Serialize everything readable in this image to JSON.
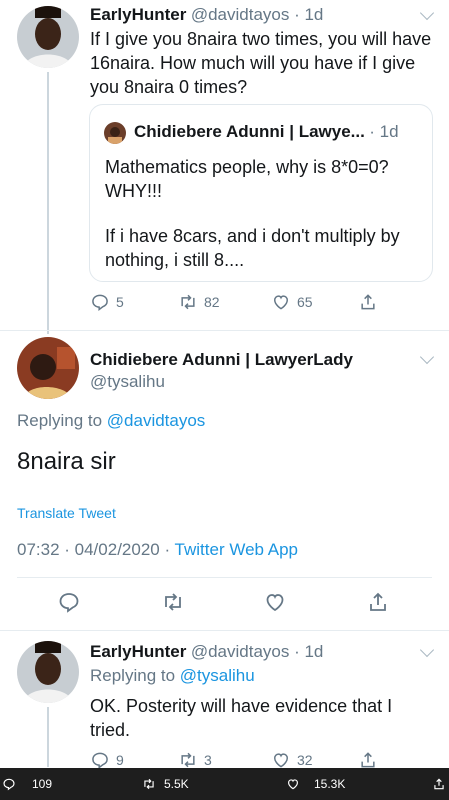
{
  "tweet1": {
    "name": "EarlyHunter",
    "handle": "@davidtayos · 1d",
    "text": "If I give you 8naira two times, you will have 16naira. How much will you have if I give you 8naira 0 times?",
    "quote": {
      "name": "Chidiebere Adunni | Lawye...",
      "time": "· 1d",
      "line1": "Mathematics people,  why is 8*0=0? WHY!!!",
      "line2": "If i have 8cars,  and i don't multiply by nothing, i still 8...."
    },
    "replies": "5",
    "retweets": "82",
    "likes": "65"
  },
  "tweet2": {
    "name": "Chidiebere Adunni | LawyerLady",
    "handle": "@tysalihu",
    "replying_prefix": "Replying to ",
    "replying_handle": "@davidtayos",
    "text": "8naira sir",
    "translate": "Translate Tweet",
    "timestamp": "07:32 · 04/02/2020 · ",
    "source": "Twitter Web App"
  },
  "tweet3": {
    "name": "EarlyHunter",
    "handle": "@davidtayos · 1d",
    "replying_prefix": "Replying to ",
    "replying_handle": "@tysalihu",
    "text": "OK. Posterity will have evidence that I tried.",
    "replies": "9",
    "retweets": "3",
    "likes": "32"
  },
  "bottom_bar": {
    "replies": "109",
    "retweets": "5.5K",
    "likes": "15.3K"
  },
  "colors": {
    "accent": "#1b95e0",
    "muted": "#657786",
    "text": "#14171a",
    "bar": "#1e1e1e"
  }
}
